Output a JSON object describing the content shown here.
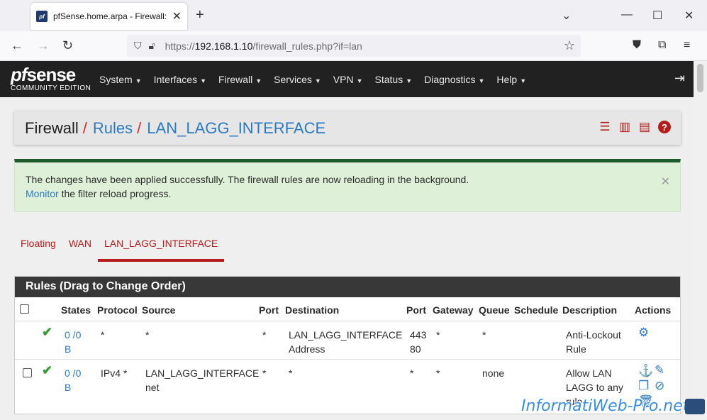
{
  "browser": {
    "tab_title": "pfSense.home.arpa - Firewall: R",
    "favicon_text": "pf",
    "url_prefix": "https://",
    "url_host": "192.168.1.10",
    "url_path": "/firewall_rules.php?if=lan"
  },
  "header": {
    "logo_main": "sense",
    "logo_pf": "pf",
    "logo_sub": "COMMUNITY EDITION",
    "menu": [
      "System",
      "Interfaces",
      "Firewall",
      "Services",
      "VPN",
      "Status",
      "Diagnostics",
      "Help"
    ]
  },
  "breadcrumb": {
    "part1": "Firewall",
    "part2": "Rules",
    "part3": "LAN_LAGG_INTERFACE",
    "sep": "/"
  },
  "alert": {
    "line1": "The changes have been applied successfully. The firewall rules are now reloading in the background.",
    "link": "Monitor",
    "line2_rest": " the filter reload progress."
  },
  "tabs": [
    "Floating",
    "WAN",
    "LAN_LAGG_INTERFACE"
  ],
  "rules_panel": {
    "title": "Rules (Drag to Change Order)",
    "columns": [
      "States",
      "Protocol",
      "Source",
      "Port",
      "Destination",
      "Port",
      "Gateway",
      "Queue",
      "Schedule",
      "Description",
      "Actions"
    ],
    "rows": [
      {
        "states_a": "0 /0",
        "states_b": "B",
        "protocol": "*",
        "source_a": "*",
        "source_b": "",
        "src_port": "*",
        "dest_a": "LAN_LAGG_INTERFACE",
        "dest_b": "Address",
        "dst_port_a": "443",
        "dst_port_b": "80",
        "gateway": "*",
        "queue": "*",
        "schedule": "",
        "desc_a": "Anti-Lockout",
        "desc_b": "Rule",
        "desc_c": ""
      },
      {
        "states_a": "0 /0",
        "states_b": "B",
        "protocol": "IPv4 *",
        "source_a": "LAN_LAGG_INTERFACE",
        "source_b": "net",
        "src_port": "*",
        "dest_a": "*",
        "dest_b": "",
        "dst_port_a": "*",
        "dst_port_b": "",
        "gateway": "*",
        "queue": "none",
        "schedule": "",
        "desc_a": "Allow LAN",
        "desc_b": "LAGG to any",
        "desc_c": "rule"
      }
    ]
  },
  "watermark": "InformatiWeb-Pro.net",
  "colors": {
    "accent": "#b71c1c",
    "link": "#2c7ac2",
    "header_bg": "#212121",
    "success_bar": "#1e5a2b"
  }
}
